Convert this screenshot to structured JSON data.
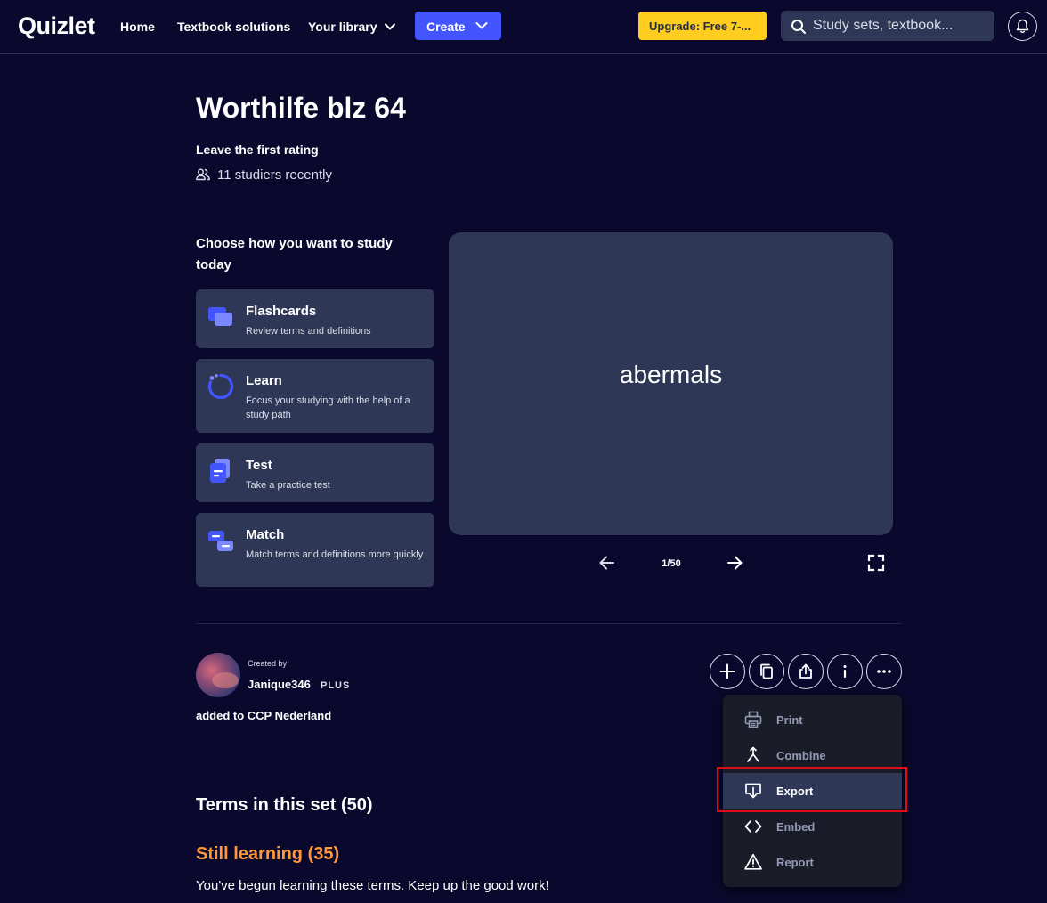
{
  "nav": {
    "logo": "Quizlet",
    "home": "Home",
    "textbook": "Textbook solutions",
    "library": "Your library",
    "create": "Create",
    "upgrade": "Upgrade: Free 7-...",
    "search_placeholder": "Study sets, textbook..."
  },
  "set": {
    "title": "Worthilfe blz 64",
    "rating": "Leave the first rating",
    "studiers": "11 studiers recently"
  },
  "study": {
    "heading": "Choose how you want to study today",
    "modes": [
      {
        "title": "Flashcards",
        "desc": "Review terms and definitions",
        "icon": "flashcards-icon"
      },
      {
        "title": "Learn",
        "desc": "Focus your studying with the help of a study path",
        "icon": "learn-icon"
      },
      {
        "title": "Test",
        "desc": "Take a practice test",
        "icon": "test-icon"
      },
      {
        "title": "Match",
        "desc": "Match terms and definitions more quickly",
        "icon": "match-icon"
      }
    ]
  },
  "card": {
    "term": "abermals",
    "counter": "1/50"
  },
  "creator": {
    "created_by": "Created by",
    "name": "Janique346",
    "badge": "PLUS",
    "added_to": "added to CCP Nederland"
  },
  "menu": {
    "items": [
      {
        "label": "Print",
        "icon": "print-icon"
      },
      {
        "label": "Combine",
        "icon": "combine-icon"
      },
      {
        "label": "Export",
        "icon": "export-icon",
        "active": true
      },
      {
        "label": "Embed",
        "icon": "embed-icon"
      },
      {
        "label": "Report",
        "icon": "report-icon"
      }
    ]
  },
  "terms": {
    "title": "Terms in this set (50)",
    "still_learning": "Still learning (35)",
    "still_desc": "You've begun learning these terms. Keep up the good work!"
  },
  "colors": {
    "background": "#0a092d",
    "surface": "#2e3856",
    "primary": "#4255ff",
    "upgrade": "#ffcd1f",
    "still_learning": "#ff983a",
    "highlight": "#e30b16"
  }
}
